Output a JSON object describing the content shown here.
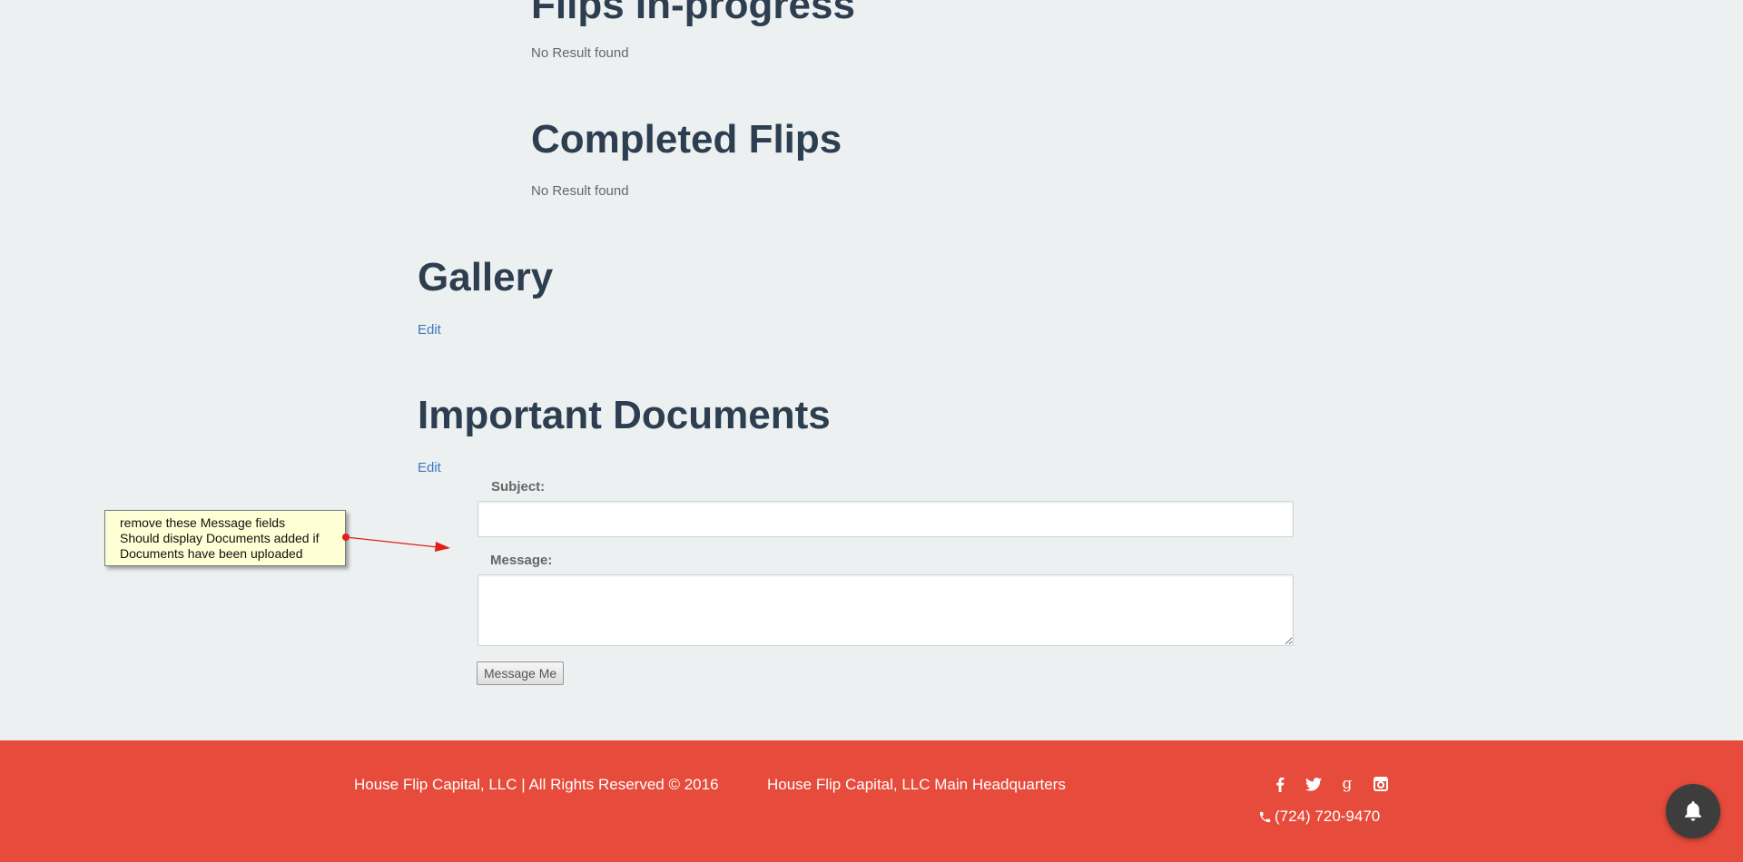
{
  "sections": {
    "in_progress": {
      "title": "Flips In-progress",
      "empty_text": "No Result found"
    },
    "completed": {
      "title": "Completed Flips",
      "empty_text": "No Result found"
    },
    "gallery": {
      "title": "Gallery",
      "edit_label": "Edit"
    },
    "documents": {
      "title": "Important Documents",
      "edit_label": "Edit"
    }
  },
  "message_form": {
    "subject_label": "Subject:",
    "subject_value": "",
    "message_label": "Message:",
    "message_value": "",
    "submit_label": "Message Me"
  },
  "annotation": {
    "lines": [
      "remove these Message fields",
      "Should display Documents added if",
      "Documents have been uploaded"
    ],
    "colors": {
      "note_bg": "#ffffd5",
      "arrow": "#e0201a"
    }
  },
  "footer": {
    "copyright": "House Flip Capital, LLC | All Rights Reserved © 2016",
    "headquarters": "House Flip Capital, LLC Main Headquarters",
    "phone": "(724) 720-9470",
    "social_icons": [
      "facebook-icon",
      "twitter-icon",
      "google-plus-icon",
      "instagram-icon"
    ],
    "colors": {
      "background": "#e64b3b",
      "text": "#ffffff"
    }
  },
  "notification": {
    "icon": "bell-icon",
    "color": "#3d3d3d"
  },
  "theme": {
    "page_bg": "#ecf0f1",
    "heading": "#2c3e50",
    "link": "#3a7abf"
  }
}
